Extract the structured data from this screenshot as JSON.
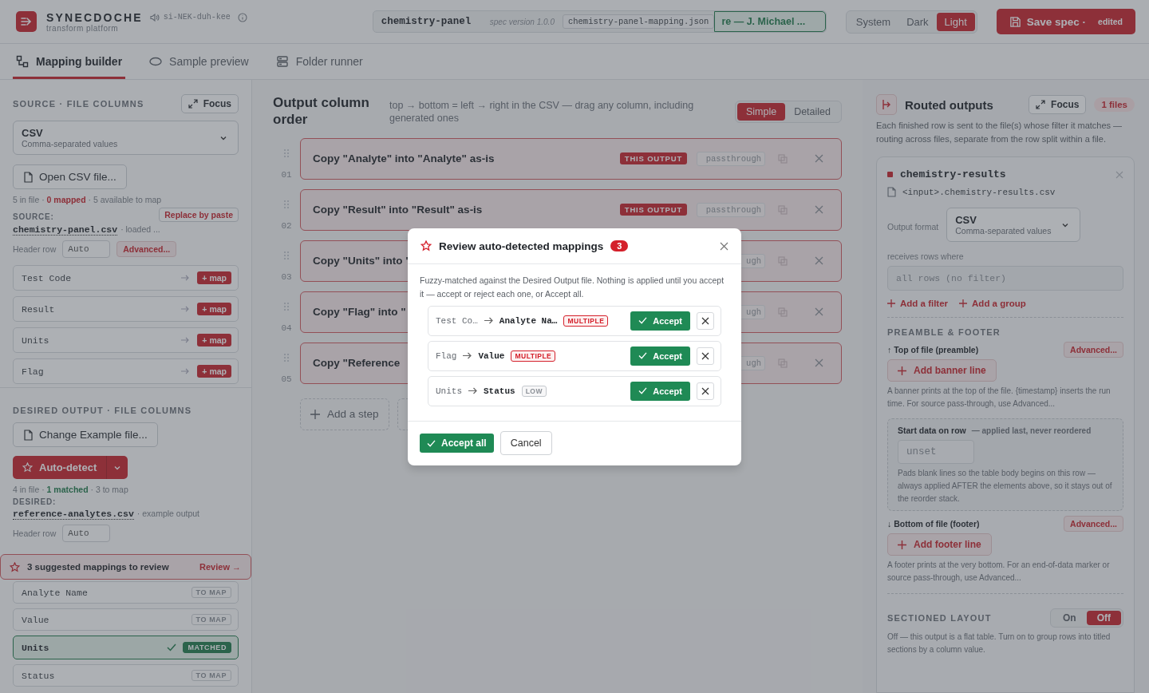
{
  "header": {
    "brand": "SYNECDOCHE",
    "pronunciation": "si-NEK-duh-kee",
    "tagline": "transform platform",
    "spec": {
      "name": "chemistry-panel",
      "version": "spec version 1.0.0",
      "file": "chemistry-panel-mapping.json",
      "author": "re — J. Michael ..."
    },
    "themes": [
      {
        "label": "System",
        "selected": false
      },
      {
        "label": "Dark",
        "selected": false
      },
      {
        "label": "Light",
        "selected": true
      }
    ],
    "save": {
      "label": "Save spec ·",
      "status": "edited"
    }
  },
  "tabs": [
    {
      "label": "Mapping builder",
      "selected": true
    },
    {
      "label": "Sample preview",
      "selected": false
    },
    {
      "label": "Folder runner",
      "selected": false
    }
  ],
  "source": {
    "heading": "SOURCE · FILE COLUMNS",
    "focus": "Focus",
    "format": {
      "name": "CSV",
      "description": "Comma-separated values"
    },
    "open_button": "Open CSV file...",
    "stats": {
      "before": "5 in file · ",
      "highlight": "0 mapped",
      "after": " · 5 available to map"
    },
    "label": "SOURCE:",
    "paste_button": "Replace by paste",
    "file": "chemistry-panel.csv",
    "file_note": "· loaded ...",
    "header_row": {
      "label": "Header row",
      "value": "Auto"
    },
    "advanced": "Advanced...",
    "columns": [
      {
        "name": "Test Code",
        "action": "+ map"
      },
      {
        "name": "Result",
        "action": "+ map"
      },
      {
        "name": "Units",
        "action": "+ map"
      },
      {
        "name": "Flag",
        "action": "+ map"
      }
    ]
  },
  "desired": {
    "heading": "DESIRED OUTPUT · FILE COLUMNS",
    "change_button": "Change Example file...",
    "detect_button": "Auto-detect",
    "stats": {
      "before": "4 in file · ",
      "highlight": "1 matched",
      "after": " · 3 to map"
    },
    "label": "DESIRED:",
    "file": "reference-analytes.csv",
    "file_note": "· example output",
    "header_row": {
      "label": "Header row",
      "value": "Auto"
    },
    "suggestion": {
      "text": "3 suggested mappings to review",
      "link": "Review →"
    },
    "columns": [
      {
        "name": "Analyte Name",
        "status": "TO MAP",
        "matched": false
      },
      {
        "name": "Value",
        "status": "TO MAP",
        "matched": false
      },
      {
        "name": "Units",
        "status": "MATCHED",
        "matched": true
      },
      {
        "name": "Status",
        "status": "TO MAP",
        "matched": false
      }
    ]
  },
  "order": {
    "title": "Output column order",
    "hint": "top → bottom = left → right in the CSV — drag any column, including generated ones",
    "modes": [
      {
        "label": "Simple",
        "selected": true
      },
      {
        "label": "Detailed",
        "selected": false
      }
    ],
    "steps": [
      {
        "number": "01",
        "text": "Copy \"Analyte\" into \"Analyte\" as-is",
        "badge": "THIS OUTPUT",
        "tag": "passthrough"
      },
      {
        "number": "02",
        "text": "Copy \"Result\" into \"Result\" as-is",
        "badge": "THIS OUTPUT",
        "tag": "passthrough"
      },
      {
        "number": "03",
        "text": "Copy \"Units\" into \"",
        "tag": "ugh"
      },
      {
        "number": "04",
        "text": "Copy \"Flag\" into \"",
        "tag": "ugh"
      },
      {
        "number": "05",
        "text": "Copy \"Reference",
        "tag": "ugh"
      }
    ],
    "add_button": "Add a step"
  },
  "routed": {
    "title": "Routed outputs",
    "focus": "Focus",
    "count": "1 files",
    "description": "Each finished row is sent to the file(s) whose filter it matches — routing across files, separate from the row split within a file.",
    "output": {
      "name": "chemistry-results",
      "path": "<input>.chemistry-results.csv",
      "format_label": "Output format",
      "format": {
        "name": "CSV",
        "description": "Comma-separated values"
      },
      "filter_label": "receives rows where",
      "filter_placeholder": "all rows (no filter)",
      "add_filter": "Add a filter",
      "add_group": "Add a group",
      "preamble_heading": "PREAMBLE & FOOTER",
      "top_label": "↑ Top of file (preamble)",
      "top_advanced": "Advanced...",
      "add_banner": "Add banner line",
      "banner_help": "A banner prints at the top of the file. {timestamp} inserts the run time. For source pass-through, use Advanced...",
      "start": {
        "label": "Start data on row",
        "note": "— applied last, never reordered",
        "placeholder": "unset",
        "help": "Pads blank lines so the table body begins on this row — always applied AFTER the elements above, so it stays out of the reorder stack."
      },
      "bottom_label": "↓ Bottom of file (footer)",
      "bottom_advanced": "Advanced...",
      "add_footer": "Add footer line",
      "footer_help": "A footer prints at the very bottom. For an end-of-data marker or source pass-through, use Advanced...",
      "sectioned_heading": "SECTIONED LAYOUT",
      "sectioned": [
        {
          "label": "On",
          "selected": false
        },
        {
          "label": "Off",
          "selected": true
        }
      ],
      "sectioned_help": "Off — this output is a flat table. Turn on to group rows into titled sections by a column value."
    }
  },
  "dialog": {
    "title": "Review auto-detected mappings",
    "count": "3",
    "intro": "Fuzzy-matched against the Desired Output file. Nothing is applied until you accept it — accept or reject each one, or Accept all.",
    "suggestions": [
      {
        "from": "Test Co…",
        "to": "Analyte Na…",
        "confidence": "MULTIPLE",
        "kind": "multiple",
        "accept": "Accept"
      },
      {
        "from": "Flag",
        "to": "Value",
        "confidence": "MULTIPLE",
        "kind": "multiple",
        "accept": "Accept"
      },
      {
        "from": "Units",
        "to": "Status",
        "confidence": "LOW",
        "kind": "low",
        "accept": "Accept"
      }
    ],
    "accept_all": "Accept all",
    "cancel": "Cancel"
  }
}
